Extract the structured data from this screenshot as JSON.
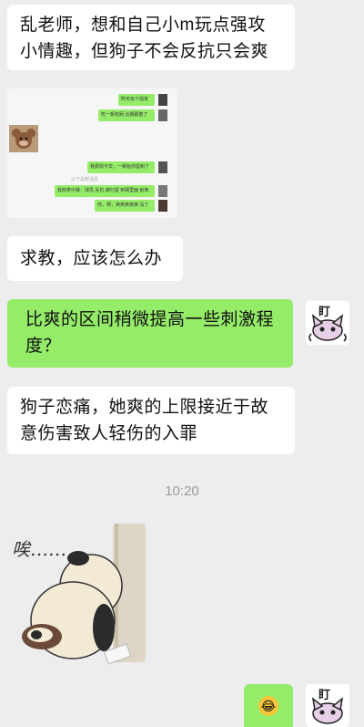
{
  "messages": [
    {
      "text": "乱老师，想和自己小m玩点强攻小情趣，但狗子不会反抗只会爽"
    },
    {
      "text": "求教，应该怎么办"
    },
    {
      "text": "比爽的区间稍微提高一些刺激程度？"
    },
    {
      "text": "狗子恋痛，她爽的上限接近于故意伤害致人轻伤的入罪"
    }
  ],
  "screenshot": {
    "bubbles": [
      "昨天玩个强攻",
      "吃一顿包厢 比赛跟着了",
      "我费劲不去，一顿给你留到了",
      "我想拿中暴：球员 反抗 被打留 到那里面 就到",
      "你，啊，爽爽爽爽爽 没了"
    ],
    "time": "以下是新消息"
  },
  "timestamp": "10:20",
  "sticker": {
    "caption": "唉……"
  },
  "avatar": {
    "label": "盯"
  },
  "last_message": {
    "emoji": "😂"
  },
  "colors": {
    "background": "#ededed",
    "right_bubble": "#95ec69",
    "left_bubble": "#ffffff"
  }
}
